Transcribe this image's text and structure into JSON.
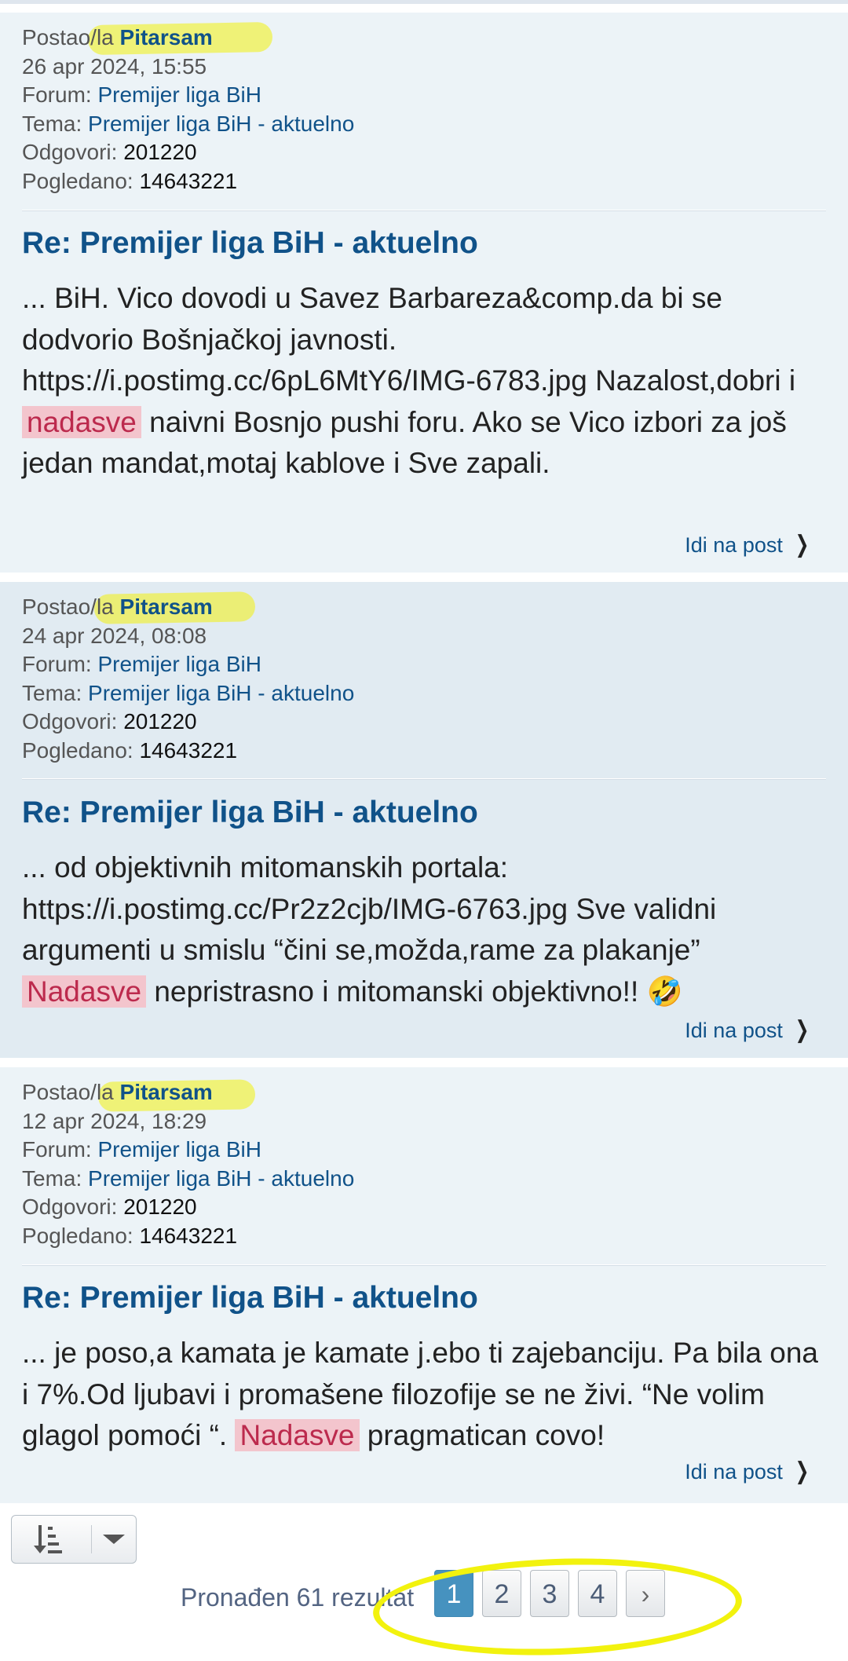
{
  "labels": {
    "posted_by": "Postao/la",
    "forum": "Forum:",
    "topic": "Tema:",
    "replies": "Odgovori:",
    "views": "Pogledano:",
    "goto_post": "Idi na post"
  },
  "posts": [
    {
      "author": "Pitarsam",
      "date": "26 apr 2024, 15:55",
      "forum": "Premijer liga BiH",
      "topic": "Premijer liga BiH - aktuelno",
      "replies": "201220",
      "views": "14643221",
      "title": "Re: Premijer liga BiH - aktuelno",
      "excerpt_before": "... BiH. Vico dovodi u Savez Barbareza&comp.da bi se dodvorio Bošnjačkoj javnosti. https://i.postimg.cc/6pL6MtY6/IMG-6783.jpg Nazalost,dobri i",
      "highlight": "nadasve",
      "excerpt_after": "naivni Bosnjo pushi foru. Ako se Vico izbori za još jedan mandat,motaj kablove i Sve zapali."
    },
    {
      "author": "Pitarsam",
      "date": "24 apr 2024, 08:08",
      "forum": "Premijer liga BiH",
      "topic": "Premijer liga BiH - aktuelno",
      "replies": "201220",
      "views": "14643221",
      "title": "Re: Premijer liga BiH - aktuelno",
      "excerpt_before": "... od objektivnih mitomanskih portala: https://i.postimg.cc/Pr2z2cjb/IMG-6763.jpg Sve validni argumenti u smislu “čini se,možda,rame za plakanje”",
      "highlight": "Nadasve",
      "excerpt_after": "nepristrasno i mitomanski objektivno!! 🤣"
    },
    {
      "author": "Pitarsam",
      "date": "12 apr 2024, 18:29",
      "forum": "Premijer liga BiH",
      "topic": "Premijer liga BiH - aktuelno",
      "replies": "201220",
      "views": "14643221",
      "title": "Re: Premijer liga BiH - aktuelno",
      "excerpt_before": "... je poso,a kamata je kamate j.ebo ti zajebanciju. Pa bila ona i 7%.Od ljubavi i promašene filozofije se ne živi. “Ne volim glagol pomoći “.",
      "highlight": "Nadasve",
      "excerpt_after": "pragmatican covo!"
    }
  ],
  "footer": {
    "results_text": "Pronađen 61 rezultat",
    "pages": [
      "1",
      "2",
      "3",
      "4"
    ],
    "current_page": "1",
    "next_label": "›"
  },
  "colors": {
    "link": "#105289",
    "highlight_bg": "#f3c5cd",
    "highlight_text": "#bc2a4d",
    "active_page": "#4692bf",
    "annotation_yellow": "#f2f20e"
  }
}
